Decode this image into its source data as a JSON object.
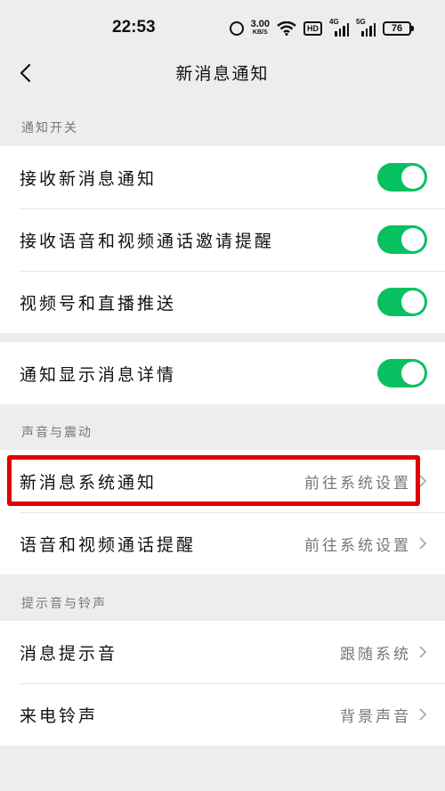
{
  "status_bar": {
    "time": "22:53",
    "speed_value": "3.00",
    "speed_unit": "KB/S",
    "hd_label": "HD",
    "sim1_label": "4G",
    "sim2_label": "5G",
    "battery": "76"
  },
  "nav": {
    "title": "新消息通知"
  },
  "sections": {
    "notification_switch": {
      "header": "通知开关",
      "items": [
        {
          "label": "接收新消息通知",
          "toggle": true
        },
        {
          "label": "接收语音和视频通话邀请提醒",
          "toggle": true
        },
        {
          "label": "视频号和直播推送",
          "toggle": true
        }
      ]
    },
    "detail": {
      "items": [
        {
          "label": "通知显示消息详情",
          "toggle": true
        }
      ]
    },
    "sound_vibration": {
      "header": "声音与震动",
      "items": [
        {
          "label": "新消息系统通知",
          "value": "前往系统设置"
        },
        {
          "label": "语音和视频通话提醒",
          "value": "前往系统设置"
        }
      ]
    },
    "tones": {
      "header": "提示音与铃声",
      "items": [
        {
          "label": "消息提示音",
          "value": "跟随系统"
        },
        {
          "label": "来电铃声",
          "value": "背景声音"
        }
      ]
    }
  },
  "colors": {
    "accent": "#07c160",
    "highlight": "#e00000",
    "background": "#ededed"
  }
}
